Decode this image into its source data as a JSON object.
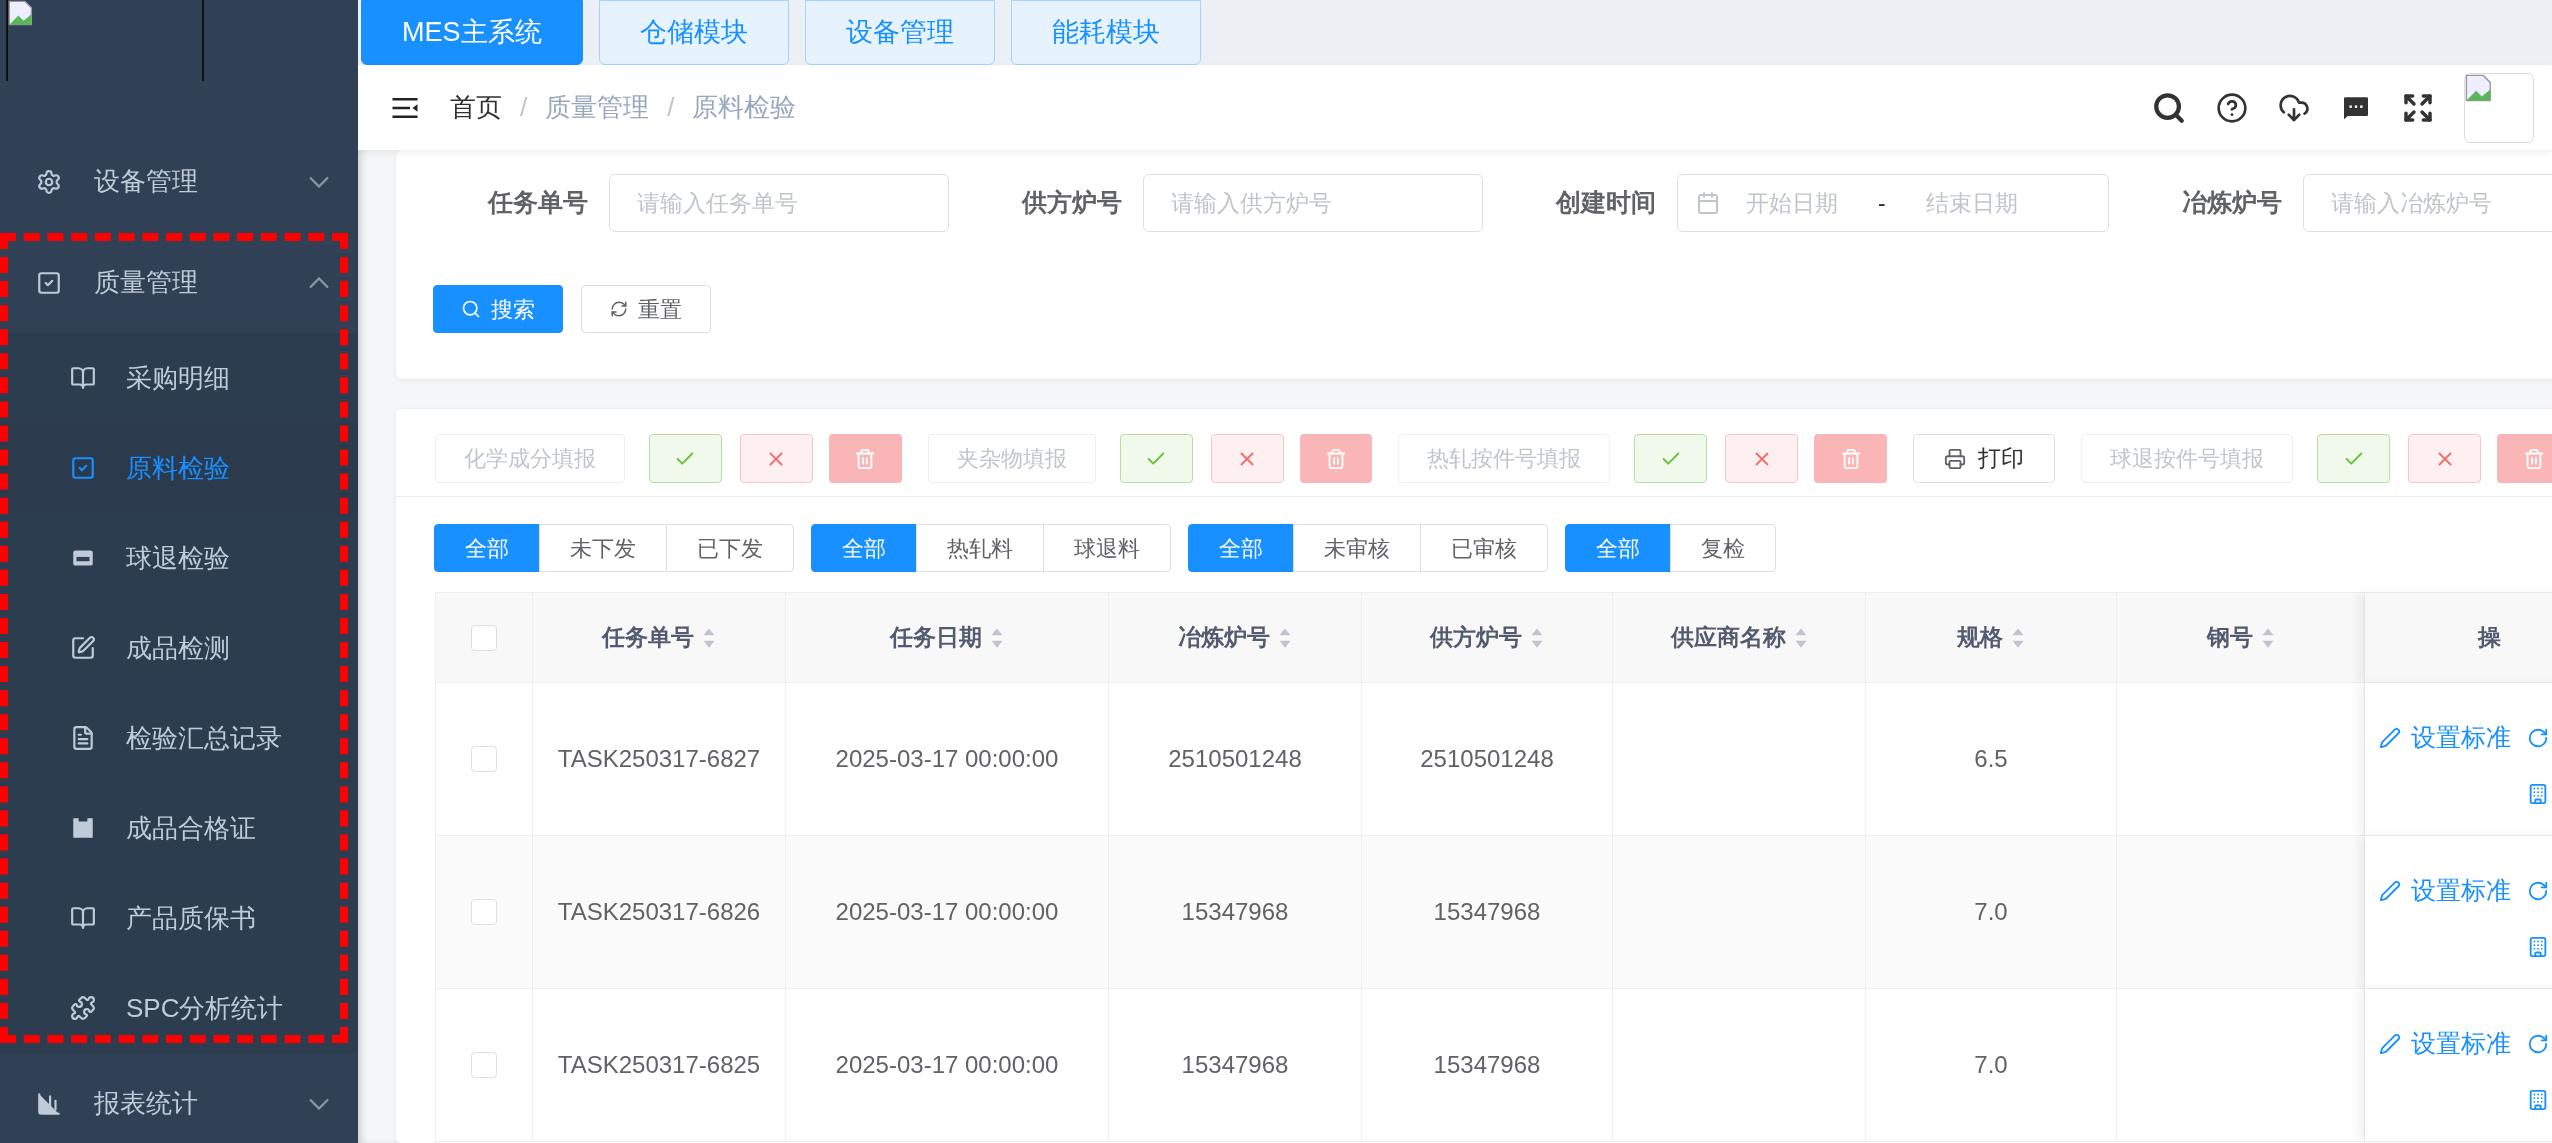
{
  "top_tabs": [
    {
      "label": "MES主系统",
      "selected": true
    },
    {
      "label": "仓储模块",
      "selected": false
    },
    {
      "label": "设备管理",
      "selected": false
    },
    {
      "label": "能耗模块",
      "selected": false
    }
  ],
  "sidebar": {
    "items": [
      {
        "label": "设备管理",
        "expanded": false,
        "selected": false
      },
      {
        "label": "质量管理",
        "expanded": true,
        "selected": false,
        "children": [
          {
            "label": "采购明细",
            "selected": false
          },
          {
            "label": "原料检验",
            "selected": true
          },
          {
            "label": "球退检验",
            "selected": false
          },
          {
            "label": "成品检测",
            "selected": false
          },
          {
            "label": "检验汇总记录",
            "selected": false
          },
          {
            "label": "成品合格证",
            "selected": false
          },
          {
            "label": "产品质保书",
            "selected": false
          },
          {
            "label": "SPC分析统计",
            "selected": false
          }
        ]
      },
      {
        "label": "报表统计",
        "expanded": false,
        "selected": false
      }
    ]
  },
  "breadcrumb": [
    {
      "label": "首页"
    },
    {
      "separator": "/",
      "label": "质量管理"
    },
    {
      "separator": "/",
      "label": "原料检验"
    }
  ],
  "search_form": {
    "fields": [
      {
        "kind": "text",
        "label": "任务单号",
        "placeholder": "请输入任务单号"
      },
      {
        "kind": "text",
        "label": "供方炉号",
        "placeholder": "请输入供方炉号"
      },
      {
        "kind": "daterange",
        "label": "创建时间",
        "start_placeholder": "开始日期",
        "separator": "-",
        "end_placeholder": "结束日期"
      },
      {
        "kind": "text",
        "label": "冶炼炉号",
        "placeholder": "请输入冶炼炉号"
      }
    ],
    "buttons": [
      {
        "kind": "primary",
        "label": "搜索"
      },
      {
        "kind": "default",
        "label": "重置"
      }
    ]
  },
  "toolbar": [
    {
      "kind": "text",
      "label": "化学成分填报",
      "disabled": true
    },
    {
      "kind": "approve",
      "disabled": true
    },
    {
      "kind": "reject",
      "disabled": true
    },
    {
      "kind": "delete",
      "disabled": true
    },
    {
      "kind": "text",
      "label": "夹杂物填报",
      "disabled": true
    },
    {
      "kind": "approve",
      "disabled": true
    },
    {
      "kind": "reject",
      "disabled": true
    },
    {
      "kind": "delete",
      "disabled": true
    },
    {
      "kind": "text",
      "label": "热轧按件号填报",
      "disabled": true
    },
    {
      "kind": "approve",
      "disabled": true
    },
    {
      "kind": "reject",
      "disabled": true
    },
    {
      "kind": "delete",
      "disabled": true
    },
    {
      "kind": "print",
      "label": "打印",
      "disabled": false
    },
    {
      "kind": "text",
      "label": "球退按件号填报",
      "disabled": true
    },
    {
      "kind": "approve",
      "disabled": true
    },
    {
      "kind": "reject",
      "disabled": true
    },
    {
      "kind": "delete",
      "disabled": true
    }
  ],
  "filter_groups": [
    [
      {
        "label": "全部",
        "selected": true
      },
      {
        "label": "未下发",
        "selected": false
      },
      {
        "label": "已下发",
        "selected": false
      }
    ],
    [
      {
        "label": "全部",
        "selected": true
      },
      {
        "label": "热轧料",
        "selected": false
      },
      {
        "label": "球退料",
        "selected": false
      }
    ],
    [
      {
        "label": "全部",
        "selected": true
      },
      {
        "label": "未审核",
        "selected": false
      },
      {
        "label": "已审核",
        "selected": false
      }
    ],
    [
      {
        "label": "全部",
        "selected": true
      },
      {
        "label": "复检",
        "selected": false
      }
    ]
  ],
  "table": {
    "header_checked": false,
    "columns": [
      {
        "label": "任务单号",
        "sortable": true
      },
      {
        "label": "任务日期",
        "sortable": true
      },
      {
        "label": "冶炼炉号",
        "sortable": true
      },
      {
        "label": "供方炉号",
        "sortable": true
      },
      {
        "label": "供应商名称",
        "sortable": true
      },
      {
        "label": "规格",
        "sortable": true
      },
      {
        "label": "钢号",
        "sortable": true
      },
      {
        "label": "操",
        "sortable": false
      }
    ],
    "rows": [
      {
        "checked": false,
        "cells": [
          "TASK250317-6827",
          "2025-03-17 00:00:00",
          "2510501248",
          "2510501248",
          null,
          "6.5",
          null
        ],
        "action": "设置标准"
      },
      {
        "checked": false,
        "cells": [
          "TASK250317-6826",
          "2025-03-17 00:00:00",
          "15347968",
          "15347968",
          null,
          "7.0",
          null
        ],
        "action": "设置标准"
      },
      {
        "checked": false,
        "cells": [
          "TASK250317-6825",
          "2025-03-17 00:00:00",
          "15347968",
          "15347968",
          null,
          "7.0",
          null
        ],
        "action": "设置标准"
      }
    ]
  }
}
